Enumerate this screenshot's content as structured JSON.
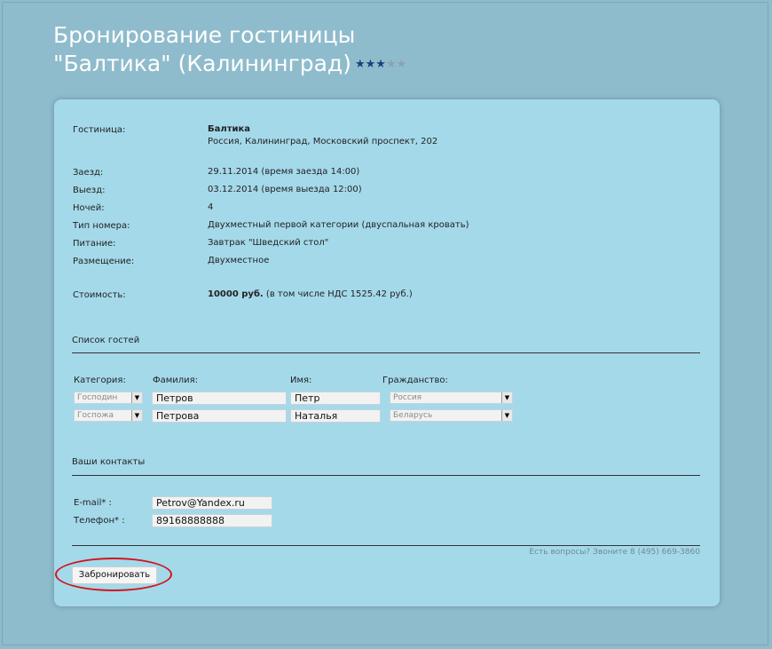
{
  "header": {
    "title_line1": "Бронирование гостиницы",
    "title_line2": "\"Балтика\" (Калининград)",
    "stars_filled": 3,
    "stars_total": 5,
    "star_glyph": "★"
  },
  "booking": {
    "hotel_label": "Гостиница:",
    "hotel_name": "Балтика",
    "hotel_address": "Россия, Калининград, Московский проспект, 202",
    "checkin_label": "Заезд:",
    "checkin_value": "29.11.2014 (время заезда 14:00)",
    "checkout_label": "Выезд:",
    "checkout_value": "03.12.2014 (время выезда 12:00)",
    "nights_label": "Ночей:",
    "nights_value": "4",
    "room_label": "Тип номера:",
    "room_value": "Двухместный первой категории (двуспальная кровать)",
    "meal_label": "Питание:",
    "meal_value": "Завтрак \"Шведский стол\"",
    "placement_label": "Размещение:",
    "placement_value": "Двухместное",
    "price_label": "Стоимость:",
    "price_value": "10000 руб.",
    "price_note": "(в том числе НДС 1525.42 руб.)"
  },
  "guests": {
    "section_title": "Список гостей",
    "col_category": "Категория:",
    "col_surname": "Фамилия:",
    "col_name": "Имя:",
    "col_citizenship": "Гражданство:",
    "rows": [
      {
        "category": "Господин",
        "surname": "Петров",
        "name": "Петр",
        "citizenship": "Россия"
      },
      {
        "category": "Госпожа",
        "surname": "Петрова",
        "name": "Наталья",
        "citizenship": "Беларусь"
      }
    ]
  },
  "contacts": {
    "section_title": "Ваши контакты",
    "email_label": "E-mail* :",
    "email_value": "Petrov@Yandex.ru",
    "phone_label": "Телефон* :",
    "phone_value": "89168888888"
  },
  "footer": {
    "hint": "Есть вопросы? Звоните 8 (495) 669-3860",
    "submit_label": "Забронировать"
  },
  "colors": {
    "background": "#8fbccc",
    "panel": "#a4d9ea",
    "star_filled": "#1c3f7a",
    "star_empty": "#8aa3ad",
    "highlight_ring": "#d2141d"
  },
  "icons": {
    "dropdown_arrow": "dropdown-arrow-icon",
    "star": "star-icon"
  }
}
